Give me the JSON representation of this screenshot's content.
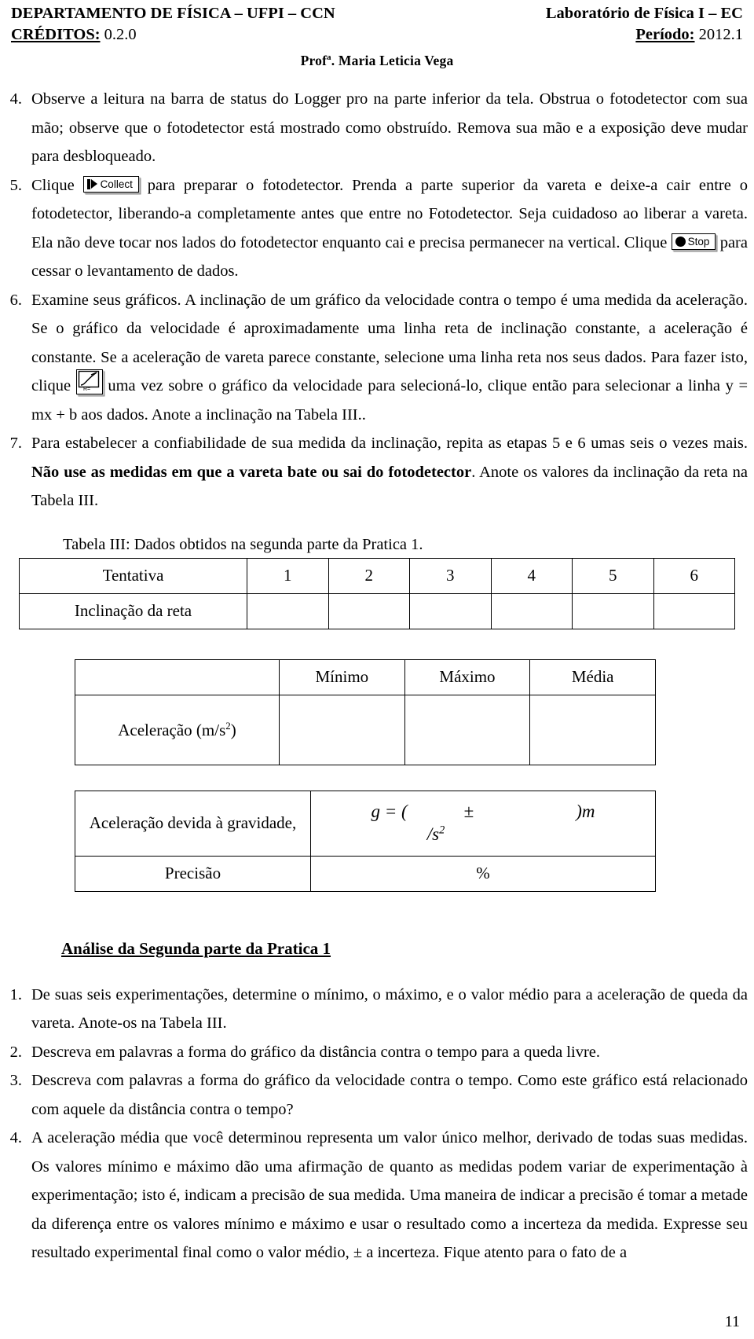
{
  "header": {
    "dept": "DEPARTAMENTO DE FÍSICA – UFPI – CCN",
    "lab": "Laboratório de Física I – EC",
    "credits_label": "CRÉDITOS:",
    "credits_value": " 0.2.0",
    "period_label": "Período:",
    "period_value": " 2012.1",
    "professor_pre": "Prof",
    "professor_sup": "a",
    "professor_post": ". Maria Leticia Vega"
  },
  "steps": [
    {
      "num": "4.",
      "text": "Observe a leitura na barra de status do Logger pro na parte inferior da tela. Obstrua o fotodetector com sua mão; observe que o fotodetector está mostrado como obstruído. Remova sua mão e a exposição deve mudar para desbloqueado."
    },
    {
      "num": "5.",
      "pre": "Clique ",
      "button": "Collect",
      "mid": " para preparar o fotodetector. Prenda a parte superior da vareta e deixe-a cair entre o fotodetector, liberando-a completamente antes que entre no Fotodetector. Seja cuidadoso ao liberar a vareta. Ela não deve tocar nos lados do fotodetector enquanto cai e precisa permanecer na vertical. Clique ",
      "button2": "Stop",
      "post": " para cessar o levantamento de dados."
    },
    {
      "num": "6.",
      "pre": "Examine seus gráficos. A inclinação de um gráfico da velocidade contra o tempo é uma medida da aceleração. Se o gráfico da velocidade é aproximadamente uma linha reta de inclinação constante, a aceleração é constante. Se a aceleração de vareta parece constante, selecione uma linha reta nos seus dados. Para fazer isto, clique ",
      "button_icon": "linear-fit-icon",
      "post": " uma vez sobre o gráfico da velocidade para selecioná-lo, clique então para selecionar a linha y = mx + b aos dados. Anote a inclinação na Tabela III.."
    },
    {
      "num": "7.",
      "p1": "Para estabelecer a confiabilidade de sua medida da inclinação, repita as etapas 5 e 6 umas seis o vezes mais. ",
      "bold": "Não use as medidas em que a vareta bate ou sai do fotodetector",
      "p2": ". Anote os valores da inclinação da reta na Tabela III."
    }
  ],
  "table3": {
    "caption": "Tabela III: Dados obtidos na segunda parte da Pratica 1.",
    "row1_label": "Tentativa",
    "row1_values": [
      "1",
      "2",
      "3",
      "4",
      "5",
      "6"
    ],
    "row2_label": "Inclinação da reta",
    "row2_values": [
      "",
      "",
      "",
      "",
      "",
      ""
    ]
  },
  "table4": {
    "corner": "",
    "headers": [
      "Mínimo",
      "Máximo",
      "Média"
    ],
    "row_label_pre": "Aceleração (m/s",
    "row_label_sup": "2",
    "row_label_post": ")",
    "row_values": [
      "",
      "",
      ""
    ]
  },
  "table5": {
    "row1_label": "Aceleração devida à gravidade,",
    "row1_value_g": "g = (",
    "row1_value_pm": "±",
    "row1_value_close": ")m",
    "row1_value_units_pre": "/s",
    "row1_value_units_sup": "2",
    "row2_label": "Precisão",
    "row2_value": "%"
  },
  "analysis": {
    "heading": "Análise da Segunda parte da Pratica 1",
    "items": [
      {
        "num": "1.",
        "text": "De suas seis experimentações, determine o mínimo, o máximo, e o valor médio para a aceleração de queda da vareta. Anote-os na Tabela III."
      },
      {
        "num": "2.",
        "text": "Descreva em palavras a forma do gráfico da distância contra o tempo para a queda livre."
      },
      {
        "num": "3.",
        "text": "Descreva com palavras a forma do gráfico da velocidade contra o tempo. Como este gráfico está relacionado com aquele da distância contra o tempo?"
      },
      {
        "num": "4.",
        "text": "A aceleração média que você determinou representa um valor único melhor, derivado de todas suas medidas. Os valores mínimo e máximo dão uma afirmação de quanto as medidas podem variar de experimentação à experimentação; isto é, indicam a precisão de sua medida. Uma maneira de indicar a precisão é tomar a metade da diferença entre os valores mínimo e máximo e usar o resultado como a incerteza da medida. Expresse seu resultado experimental final como o valor médio, ± a incerteza. Fique atento para o fato de a"
      }
    ]
  },
  "footer": {
    "page_number": "11"
  }
}
